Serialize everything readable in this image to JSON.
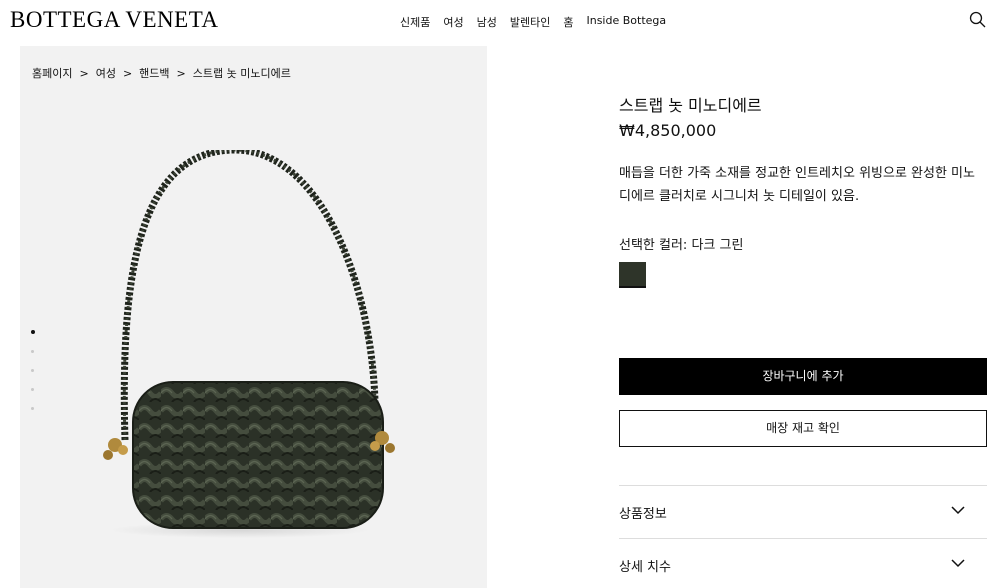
{
  "header": {
    "logo": "BOTTEGA VENETA",
    "nav": [
      "신제품",
      "여성",
      "남성",
      "발렌타인",
      "홈",
      "Inside Bottega"
    ],
    "search_icon": "search-icon"
  },
  "breadcrumb": {
    "items": [
      "홈페이지",
      "여성",
      "핸드백",
      "스트랩 놋 미노디에르"
    ],
    "separator": ">"
  },
  "gallery": {
    "image_count": 5,
    "active_index": 0
  },
  "product": {
    "title": "스트랩 놋 미노디에르",
    "price": "₩4,850,000",
    "description": "매듭을 더한 가죽 소재를 정교한 인트레치오 위빙으로 완성한 미노디에르 클러치로 시그니처 놋 디테일이 있음.",
    "color_label": "선택한 컬러: 다크 그린",
    "swatch_color": "#2e3429",
    "add_to_cart": "장바구니에 추가",
    "check_stock": "매장 재고 확인"
  },
  "accordion": [
    {
      "label": "상품정보"
    },
    {
      "label": "상세 치수"
    }
  ]
}
